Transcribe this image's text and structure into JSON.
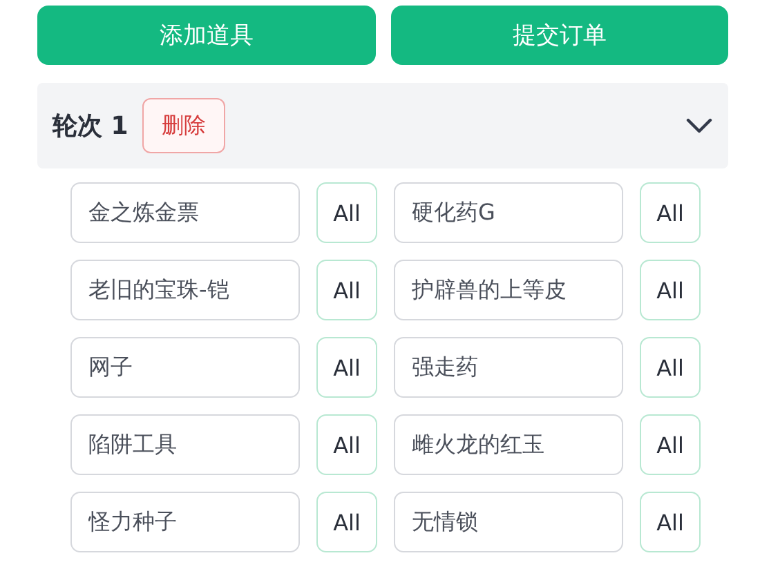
{
  "actions": [
    {
      "label": "添加道具"
    },
    {
      "label": "提交订单"
    }
  ],
  "round": {
    "title": "轮次 1",
    "delete_label": "删除",
    "expanded": true,
    "items": [
      {
        "name": "金之炼金票",
        "all": "All"
      },
      {
        "name": "硬化药G",
        "all": "All"
      },
      {
        "name": "老旧的宝珠-铠",
        "all": "All"
      },
      {
        "name": "护辟兽的上等皮",
        "all": "All"
      },
      {
        "name": "网子",
        "all": "All"
      },
      {
        "name": "强走药",
        "all": "All"
      },
      {
        "name": "陷阱工具",
        "all": "All"
      },
      {
        "name": "雌火龙的红玉",
        "all": "All"
      },
      {
        "name": "怪力种子",
        "all": "All"
      },
      {
        "name": "无情锁",
        "all": "All"
      }
    ]
  }
}
